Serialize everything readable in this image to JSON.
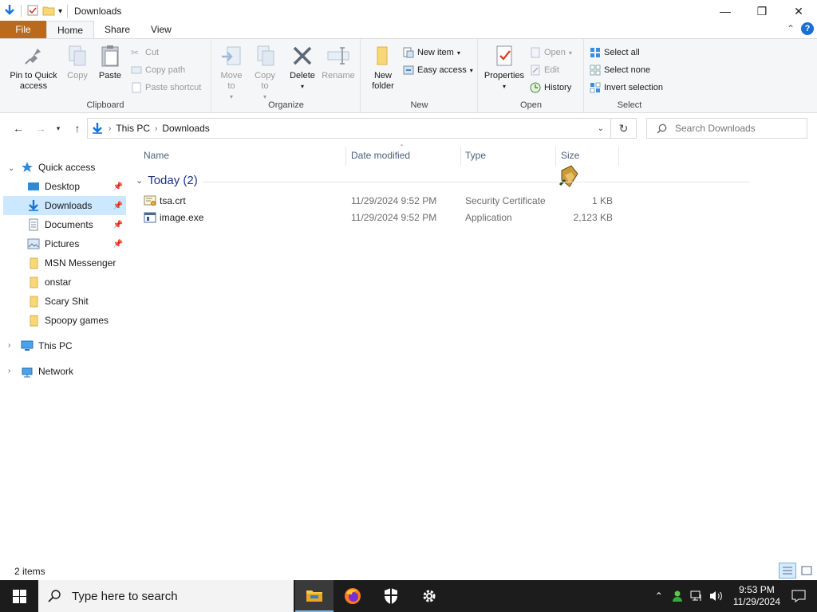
{
  "window": {
    "title": "Downloads",
    "controls": {
      "minimize": "—",
      "maximize": "❐",
      "close": "✕"
    }
  },
  "ribbon_tabs": [
    "File",
    "Home",
    "Share",
    "View"
  ],
  "ribbon": {
    "clipboard": {
      "label": "Clipboard",
      "pin": "Pin to Quick access",
      "copy": "Copy",
      "paste": "Paste",
      "cut": "Cut",
      "copy_path": "Copy path",
      "paste_shortcut": "Paste shortcut"
    },
    "organize": {
      "label": "Organize",
      "move_to": "Move to",
      "copy_to": "Copy to",
      "delete": "Delete",
      "rename": "Rename"
    },
    "new": {
      "label": "New",
      "new_folder": "New folder",
      "new_item": "New item",
      "easy_access": "Easy access"
    },
    "open": {
      "label": "Open",
      "properties": "Properties",
      "open": "Open",
      "edit": "Edit",
      "history": "History"
    },
    "select": {
      "label": "Select",
      "select_all": "Select all",
      "select_none": "Select none",
      "invert": "Invert selection"
    }
  },
  "address": {
    "crumbs": [
      "This PC",
      "Downloads"
    ],
    "search_placeholder": "Search Downloads"
  },
  "nav": {
    "quick_access": "Quick access",
    "items": [
      {
        "label": "Desktop",
        "pinned": true
      },
      {
        "label": "Downloads",
        "pinned": true,
        "selected": true
      },
      {
        "label": "Documents",
        "pinned": true
      },
      {
        "label": "Pictures",
        "pinned": true
      },
      {
        "label": "MSN Messenger"
      },
      {
        "label": "onstar"
      },
      {
        "label": "Scary Shit"
      },
      {
        "label": "Spoopy games"
      }
    ],
    "this_pc": "This PC",
    "network": "Network"
  },
  "columns": {
    "name": "Name",
    "date": "Date modified",
    "type": "Type",
    "size": "Size"
  },
  "group": "Today (2)",
  "files": [
    {
      "name": "tsa.crt",
      "date": "11/29/2024 9:52 PM",
      "type": "Security Certificate",
      "size": "1 KB",
      "icon": "certificate-icon"
    },
    {
      "name": "image.exe",
      "date": "11/29/2024 9:52 PM",
      "type": "Application",
      "size": "2,123 KB",
      "icon": "application-icon"
    }
  ],
  "status": {
    "item_count": "2 items"
  },
  "taskbar": {
    "search_placeholder": "Type here to search",
    "time": "9:53 PM",
    "date": "11/29/2024"
  }
}
